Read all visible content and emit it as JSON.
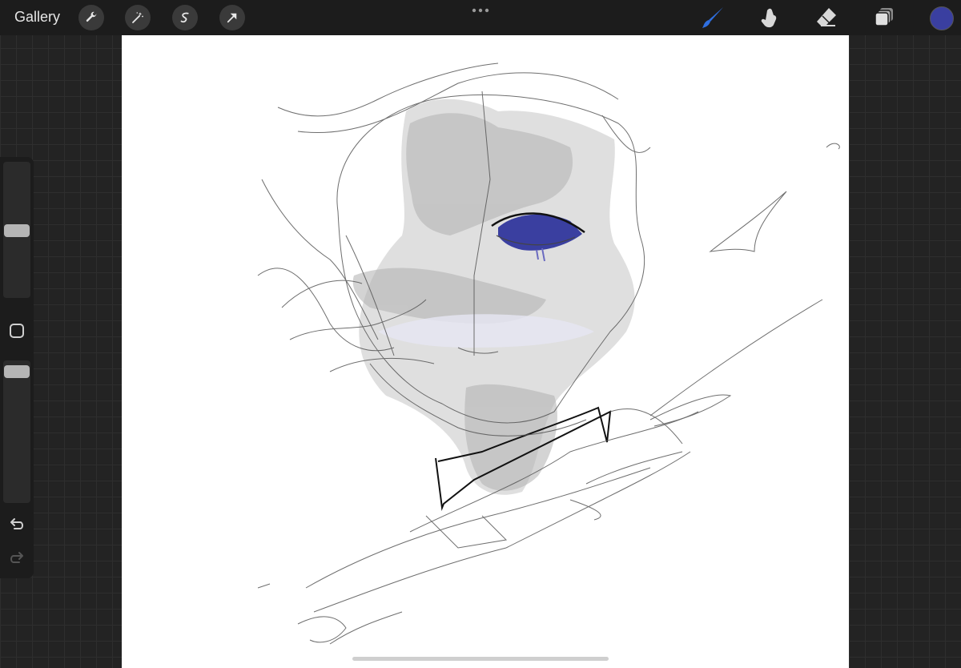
{
  "topbar": {
    "gallery_label": "Gallery",
    "left_tools": [
      "wrench-icon",
      "magic-wand-icon",
      "selection-s-icon",
      "transform-arrow-icon"
    ],
    "right_tools": [
      "brush-icon",
      "smudge-icon",
      "eraser-icon",
      "layers-icon"
    ],
    "active_tool": "brush-icon",
    "current_color": "#3a3fa0",
    "accent_color": "#2f6fe0"
  },
  "sidebar": {
    "brush_size_level": 0.5,
    "opacity_level": 0.5,
    "buttons": [
      "modify-square-icon",
      "undo-icon",
      "redo-icon"
    ]
  },
  "canvas": {
    "background": "#ffffff",
    "eye_color": "#3a3fa0"
  }
}
